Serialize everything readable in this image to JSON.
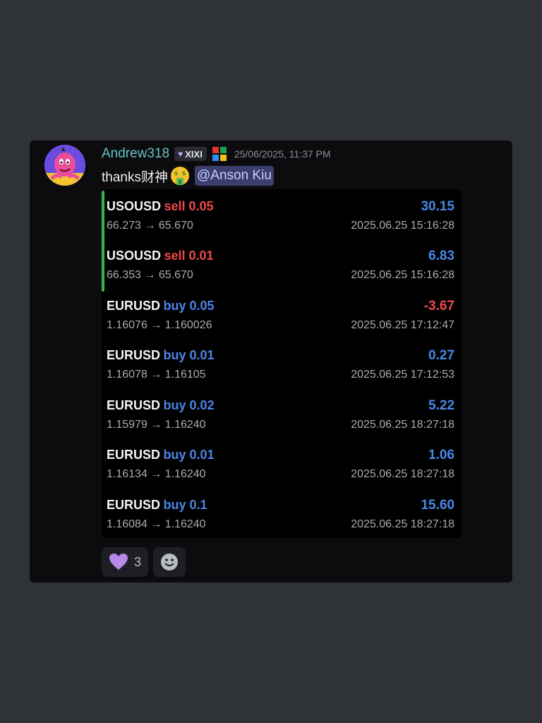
{
  "colors": {
    "background": "#2f3237",
    "card": "#0c0c0e",
    "username": "#67c1c7",
    "mention_bg": "#3b3f6e",
    "sell": "#ef4949",
    "buy": "#4a87e8",
    "accent_bar": "#37b24d"
  },
  "message": {
    "username": "Andrew318",
    "tag": "XIXI",
    "timestamp": "25/06/2025, 11:37 PM",
    "text": "thanks财神",
    "emoji": "money-mouth-face-icon",
    "mention": "@Anson Kiu"
  },
  "trades": [
    {
      "symbol": "USOUSD",
      "side": "sell 0.05",
      "pnl": "30.15",
      "prices": "66.273 → 65.670",
      "time": "2025.06.25 15:16:28"
    },
    {
      "symbol": "USOUSD",
      "side": "sell 0.01",
      "pnl": "6.83",
      "prices": "66.353 → 65.670",
      "time": "2025.06.25 15:16:28"
    },
    {
      "symbol": "EURUSD",
      "side": "buy 0.05",
      "pnl": "-3.67",
      "prices": "1.16076 → 1.160026",
      "time": "2025.06.25 17:12:47"
    },
    {
      "symbol": "EURUSD",
      "side": "buy 0.01",
      "pnl": "0.27",
      "prices": "1.16078 → 1.16105",
      "time": "2025.06.25 17:12:53"
    },
    {
      "symbol": "EURUSD",
      "side": "buy 0.02",
      "pnl": "5.22",
      "prices": "1.15979 → 1.16240",
      "time": "2025.06.25 18:27:18"
    },
    {
      "symbol": "EURUSD",
      "side": "buy 0.01",
      "pnl": "1.06",
      "prices": "1.16134 → 1.16240",
      "time": "2025.06.25 18:27:18"
    },
    {
      "symbol": "EURUSD",
      "side": "buy 0.1",
      "pnl": "15.60",
      "prices": "1.16084 → 1.16240",
      "time": "2025.06.25 18:27:18"
    }
  ],
  "reactions": [
    {
      "icon": "purple-heart-icon",
      "count": "3"
    },
    {
      "icon": "add-reaction-icon"
    }
  ]
}
